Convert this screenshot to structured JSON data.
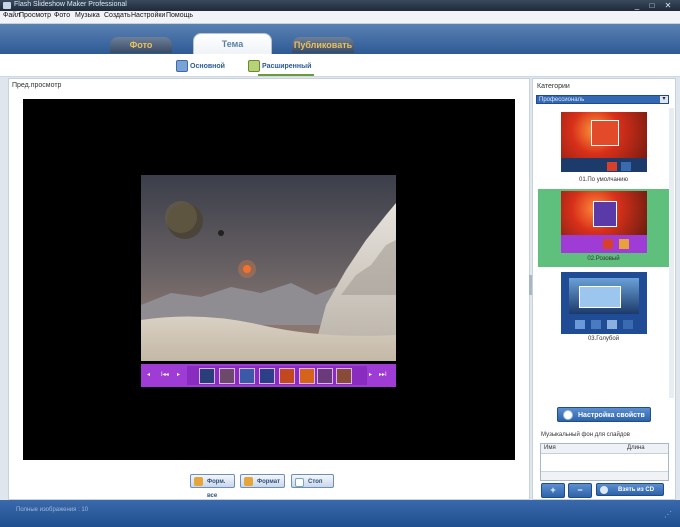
{
  "window": {
    "title": "Flash Slideshow Maker Professional",
    "controls": [
      "_",
      "□",
      "✕"
    ]
  },
  "menu": {
    "items": [
      "Файл",
      "Просмотр",
      "Фото",
      "Музыка",
      "Создать",
      "Настройки",
      "Помощь"
    ]
  },
  "tabs": {
    "photo": "Фото",
    "theme": "Тема",
    "publish": "Публиковать"
  },
  "subtabs": {
    "basic": "Основной",
    "advanced": "Расширенный"
  },
  "preview": {
    "label": "Пред.просмотр"
  },
  "filmstrip": {
    "prev": "◂",
    "first": "I◂◂",
    "play": "▸",
    "next": "▸",
    "last": "▸▸I"
  },
  "buttons": {
    "fullscreen": "Форм. все",
    "format": "Формат",
    "stop": "Стоп"
  },
  "categories": {
    "label": "Категории",
    "selected": "Профессиональ"
  },
  "themes": [
    {
      "caption": "01.По умолчанию"
    },
    {
      "caption": "02.Розовый"
    },
    {
      "caption": "03.Голубой"
    }
  ],
  "props_button": "Настройка свойств",
  "music": {
    "label": "Музыкальный фон для слайдов",
    "col_name": "Имя",
    "col_length": "Длина"
  },
  "music_buttons": {
    "add": "+",
    "remove": "−",
    "burn": "Взять из CD"
  },
  "status": {
    "text": "Полные изображения : 10"
  },
  "colors": {
    "accent_blue": "#2e5a95",
    "filmstrip_purple": "#a03cd6",
    "selected_theme": "#5fbf7d"
  }
}
